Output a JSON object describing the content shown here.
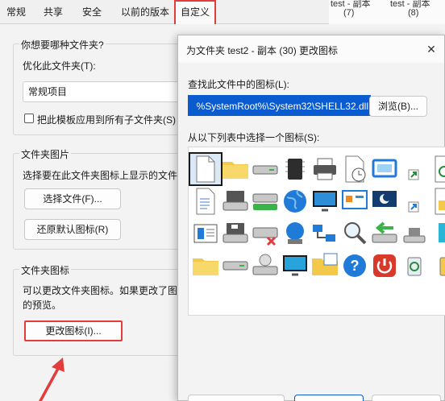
{
  "tabs": [
    "常规",
    "共享",
    "安全",
    "以前的版本",
    "自定义"
  ],
  "background_items": [
    {
      "name": "test - 副本",
      "count": "(7)"
    },
    {
      "name": "test - 副本",
      "count": "(8)"
    }
  ],
  "folder_type": {
    "title": "你想要哪种文件夹?",
    "optimize_label": "优化此文件夹(T):",
    "optimize_value": "常规项目",
    "apply_subfolders_label": "把此模板应用到所有子文件夹(S)"
  },
  "folder_picture": {
    "title": "文件夹图片",
    "description": "选择要在此文件夹图标上显示的文件",
    "choose_file_button": "选择文件(F)...",
    "restore_default_button": "还原默认图标(R)"
  },
  "folder_icon": {
    "title": "文件夹图标",
    "description_line1": "可以更改文件夹图标。如果更改了图",
    "description_line2": "的预览。",
    "change_icon_button": "更改图标(I)..."
  },
  "dialog": {
    "title": "为文件夹 test2 - 副本 (30) 更改图标",
    "close_glyph": "✕",
    "find_label": "查找此文件中的图标(L):",
    "path_value": "%SystemRoot%\\System32\\SHELL32.dll",
    "browse_button": "浏览(B)...",
    "select_label": "从以下列表中选择一个图标(S):"
  },
  "icon_grid": [
    [
      "blank-document-icon",
      "folder-icon",
      "drive-icon",
      "chip-icon",
      "printer-icon",
      "clock-document-icon",
      "window-icon",
      "shortcut-icon",
      "recycle-document-icon"
    ],
    [
      "text-document-icon",
      "hard-drive-icon",
      "green-drive-icon",
      "globe-icon",
      "monitor-globe-icon",
      "control-panel-icon",
      "moon-monitor-icon",
      "shortcut-arrow-icon",
      "image-file-icon"
    ],
    [
      "list-document-icon",
      "floppy-icon",
      "network-drive-x-icon",
      "network-globe-icon",
      "network-icon",
      "magnifier-icon",
      "green-arrow-drive-icon",
      "usb-icon",
      "cyan-block-icon"
    ],
    [
      "folder-yellow-icon",
      "drive-small-icon",
      "cd-drive-icon",
      "monitor-icon",
      "folder-grid-icon",
      "help-icon",
      "power-icon",
      "recycle-bin-icon",
      "recycle-empty-icon"
    ]
  ],
  "colors": {
    "highlight_red": "#e23c3c",
    "selection_blue": "#0a5ad0",
    "folder_yellow": "#f4c94a",
    "accent_blue": "#1f7ad8"
  }
}
